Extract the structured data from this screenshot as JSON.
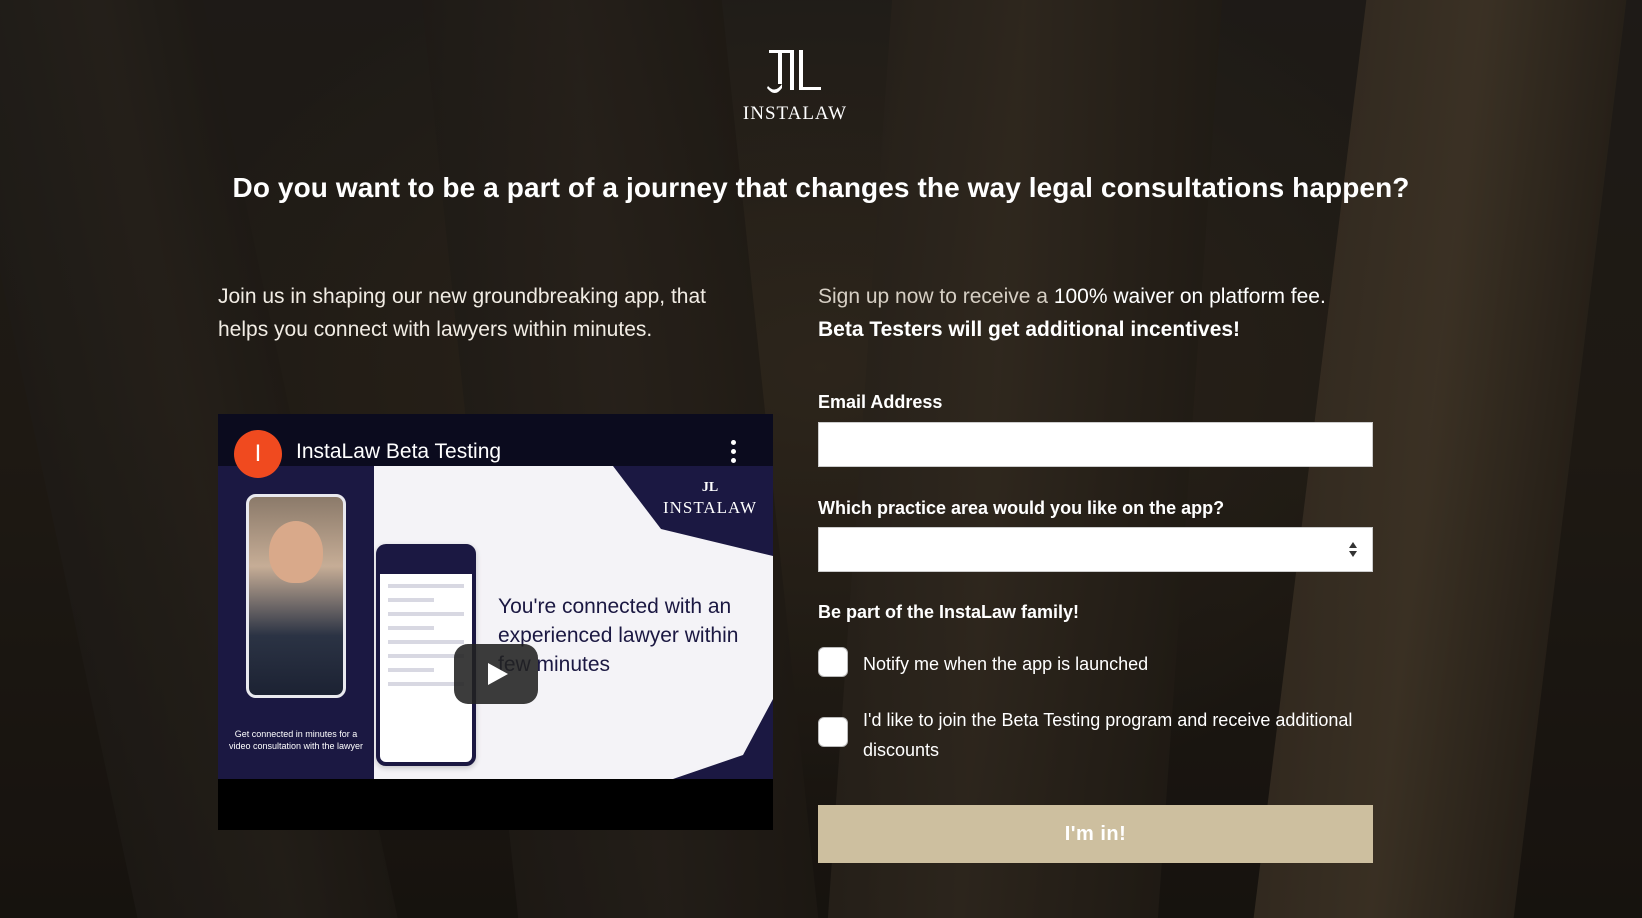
{
  "brand": {
    "name": "INSTALAW"
  },
  "headline": "Do you want to be a part of a journey that changes the way legal consultations happen?",
  "intro": "Join us in shaping our new groundbreaking app, that helps you connect with lawyers within minutes.",
  "video": {
    "avatar_letter": "I",
    "title": "InstaLaw Beta Testing",
    "icons": {
      "menu": "more-vert-icon",
      "play": "play-icon"
    },
    "thumbnail": {
      "brand": "INSTALAW",
      "headline": "You're connected with an experienced lawyer within few minutes",
      "caption": "Get connected in minutes for a video consultation with the lawyer"
    }
  },
  "signup": {
    "line1_prefix": "Sign up now to receive a ",
    "line1_highlight": "100% waiver",
    "line1_suffix": " on platform fee.",
    "line2": "Beta Testers will get additional incentives!"
  },
  "form": {
    "email_label": "Email Address",
    "email_value": "",
    "practice_label": "Which practice area would you like on the app?",
    "practice_value": "",
    "family_label": "Be part of the InstaLaw family!",
    "checkbox_notify": "Notify me when the app is launched",
    "checkbox_beta": "I'd like to join the Beta Testing program and receive additional discounts",
    "submit_label": "I'm in!"
  },
  "colors": {
    "button": "#cdbf9f",
    "video_brand": "#1b1842",
    "avatar": "#f04a1f"
  }
}
